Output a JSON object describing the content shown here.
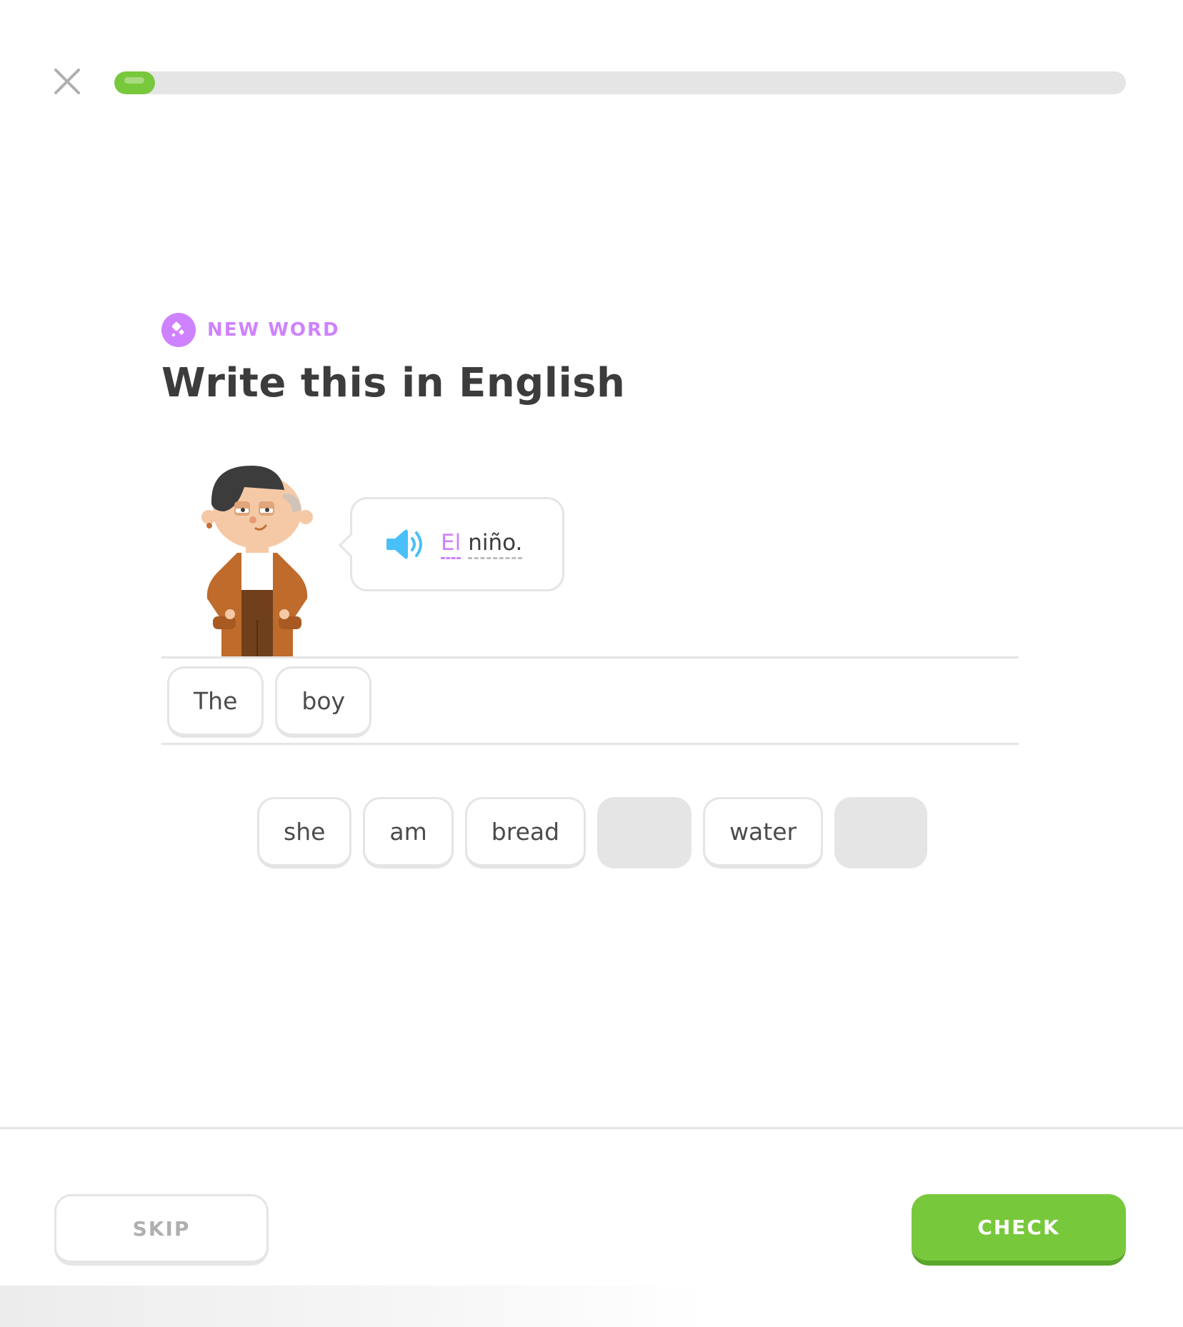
{
  "header": {
    "progress_fraction": 0.04,
    "close_icon": "close-icon"
  },
  "challenge": {
    "badge_label": "NEW WORD",
    "badge_icon": "new-word-icon",
    "title": "Write this in English",
    "prompt_words": [
      {
        "text": "El",
        "is_new": true
      },
      {
        "text": "niño.",
        "is_new": false
      }
    ],
    "speaker_icon": "speaker-icon"
  },
  "answer": {
    "selected_tiles": [
      "The",
      "boy"
    ]
  },
  "word_bank": {
    "tiles": [
      {
        "text": "she",
        "used": false
      },
      {
        "text": "am",
        "used": false
      },
      {
        "text": "bread",
        "used": false
      },
      {
        "text": "",
        "used": true
      },
      {
        "text": "water",
        "used": false
      },
      {
        "text": "",
        "used": true
      }
    ]
  },
  "footer": {
    "skip_label": "SKIP",
    "check_label": "CHECK"
  },
  "colors": {
    "accent_green": "#78c83c",
    "accent_purple": "#ce82ff",
    "speaker_blue": "#49c0f8",
    "border_gray": "#e5e5e5"
  }
}
